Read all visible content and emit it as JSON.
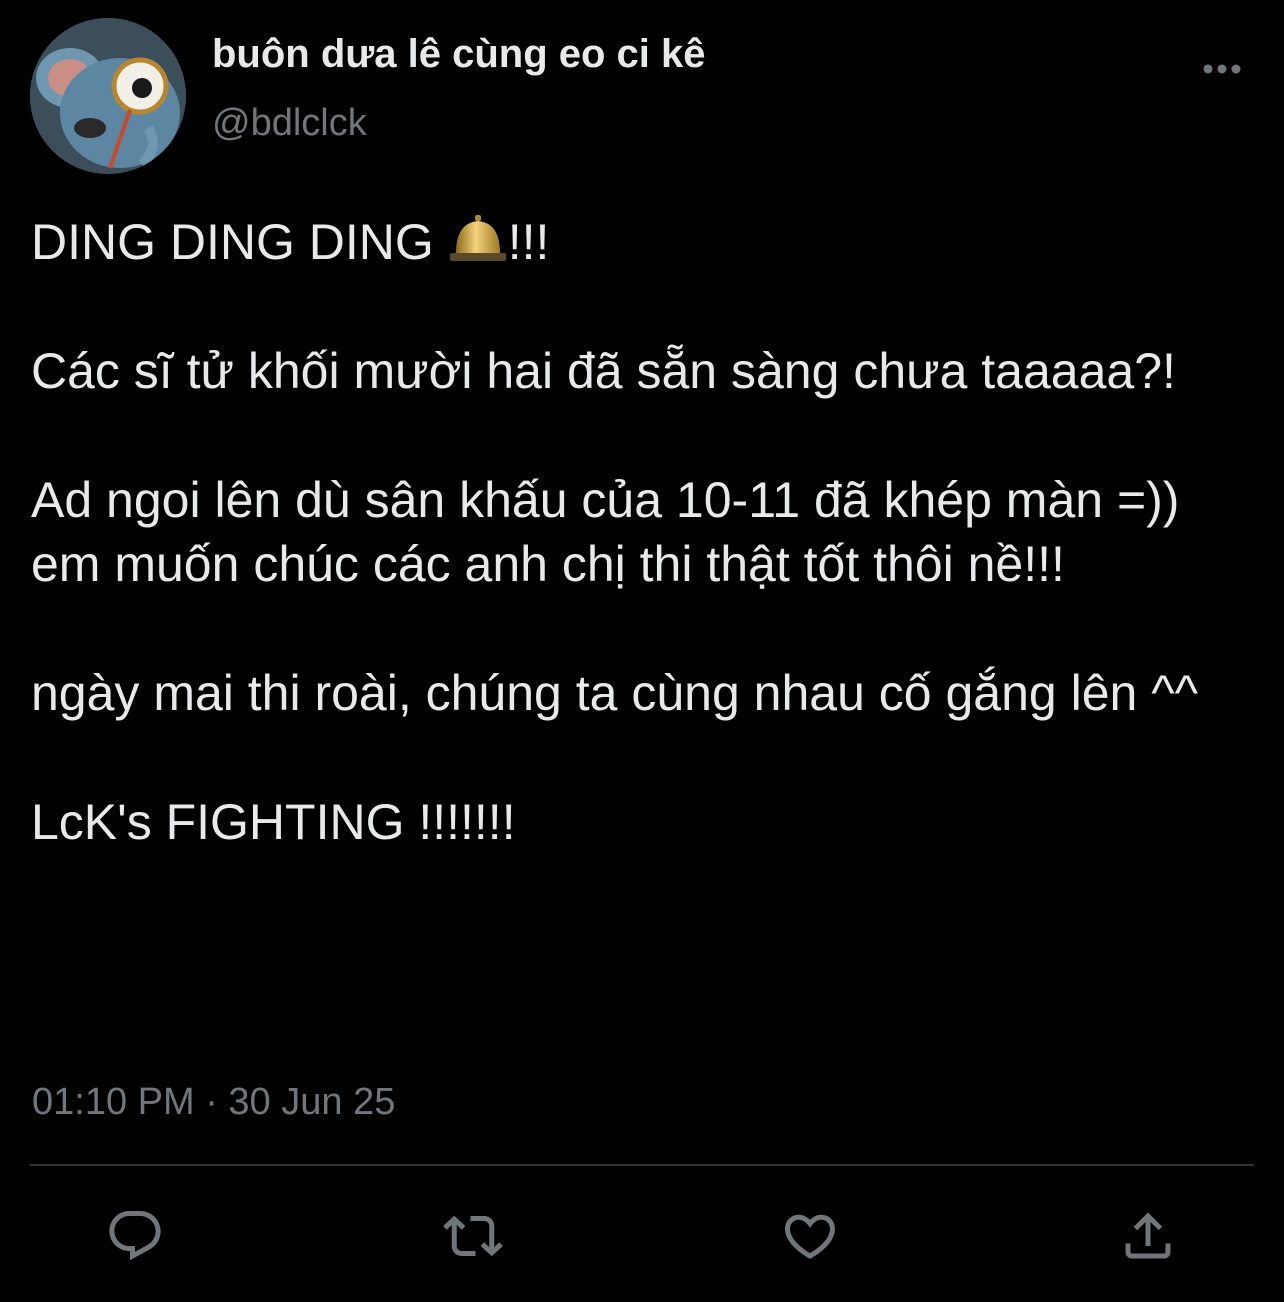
{
  "user": {
    "display_name": "buôn dưa lê cùng eo ci kê",
    "handle": "@bdlclck",
    "avatar_icon": "cartoon-mouse-avatar"
  },
  "tweet": {
    "line1_text": "DING DING DING",
    "line1_emoji": "bell-icon",
    "line1_suffix": "!!!",
    "paragraph2": "Các sĩ tử khối mười hai đã sẵn sàng chưa taaaaa?!",
    "paragraph3": "Ad ngoi lên dù sân khấu của 10-11 đã khép màn =)) em muốn chúc các anh chị thi thật tốt thôi nề!!!",
    "paragraph4": "ngày mai thi roài, chúng ta cùng nhau cố gắng lên ^^",
    "paragraph5": "LcK's FIGHTING !!!!!!!"
  },
  "meta": {
    "timestamp": "01:10 PM · 30 Jun 25"
  },
  "actions": [
    "reply-icon",
    "retweet-icon",
    "like-icon",
    "share-icon"
  ],
  "colors": {
    "background": "#000000",
    "text": "#e7e9ea",
    "secondary": "#71767b",
    "divider": "#2f3336"
  }
}
